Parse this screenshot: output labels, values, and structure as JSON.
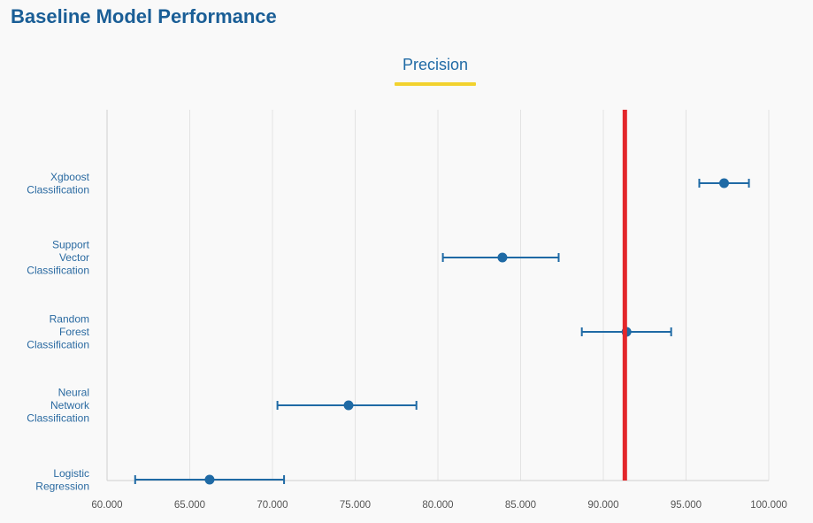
{
  "page": {
    "title": "Baseline Model Performance"
  },
  "tabs": [
    {
      "label": "Precision",
      "active": true
    }
  ],
  "colors": {
    "accent": "#1f6aa5",
    "title": "#1a5e96",
    "threshold": "#e3262b",
    "tab_underline": "#f2d22e"
  },
  "chart_data": {
    "type": "scatter",
    "title": "Precision",
    "xlabel": "",
    "ylabel": "",
    "xlim": [
      60,
      100
    ],
    "x_ticks": [
      "60.000",
      "65.000",
      "70.000",
      "75.000",
      "80.000",
      "85.000",
      "90.000",
      "95.000",
      "100.000"
    ],
    "grid": true,
    "threshold": 91.3,
    "categories": [
      {
        "label_lines": [
          "Xgboost",
          "Classification"
        ],
        "value": 97.3,
        "low": 95.8,
        "high": 98.8
      },
      {
        "label_lines": [
          "Support",
          "Vector",
          "Classification"
        ],
        "value": 83.9,
        "low": 80.3,
        "high": 87.3
      },
      {
        "label_lines": [
          "Random",
          "Forest",
          "Classification"
        ],
        "value": 91.4,
        "low": 88.7,
        "high": 94.1
      },
      {
        "label_lines": [
          "Neural",
          "Network",
          "Classification"
        ],
        "value": 74.6,
        "low": 70.3,
        "high": 78.7
      },
      {
        "label_lines": [
          "Logistic",
          "Regression"
        ],
        "value": 66.2,
        "low": 61.7,
        "high": 70.7
      }
    ]
  }
}
